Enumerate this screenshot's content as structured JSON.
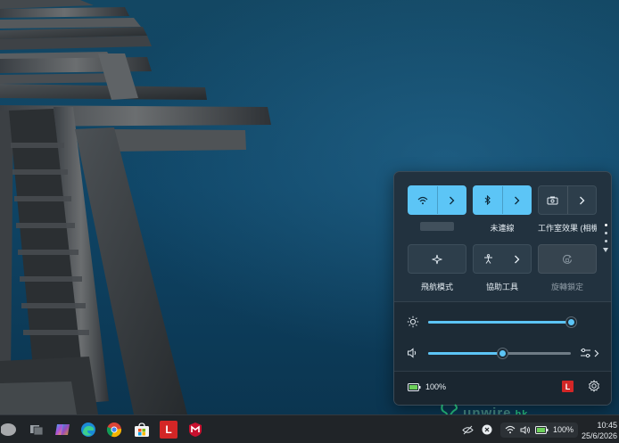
{
  "quick_settings": {
    "tiles": [
      {
        "id": "wifi",
        "label": "",
        "state": "on",
        "icon": "wifi-icon",
        "has_chevron": true
      },
      {
        "id": "bluetooth",
        "label": "未連線",
        "state": "on",
        "icon": "bluetooth-icon",
        "has_chevron": true
      },
      {
        "id": "studio_effects",
        "label": "工作室效果 (相機)",
        "state": "off",
        "icon": "camera-effects-icon",
        "has_chevron": true
      },
      {
        "id": "airplane",
        "label": "飛航模式",
        "state": "off",
        "icon": "airplane-icon",
        "has_chevron": false
      },
      {
        "id": "accessibility",
        "label": "協助工具",
        "state": "off",
        "icon": "accessibility-icon",
        "has_chevron": true
      },
      {
        "id": "rotation_lock",
        "label": "旋轉鎖定",
        "state": "disabled",
        "icon": "rotation-lock-icon",
        "has_chevron": false
      }
    ],
    "pager": {
      "pages": 3,
      "active": 0
    },
    "brightness": {
      "icon": "brightness-icon",
      "level_percent": 100
    },
    "volume": {
      "icon": "speaker-icon",
      "level_percent": 52,
      "extra_icon": "audio-output-icon"
    },
    "battery": {
      "icon": "battery-icon",
      "label": "100%"
    },
    "app_badge": {
      "letter": "L",
      "color": "#d32626"
    },
    "settings_icon": "gear-icon"
  },
  "taskbar": {
    "apps": [
      {
        "name": "start-button",
        "icon": "start-icon"
      },
      {
        "name": "taskbar-app-task-view",
        "icon": "task-view-icon"
      },
      {
        "name": "taskbar-app-copilot",
        "icon": "copilot-icon"
      },
      {
        "name": "taskbar-app-edge",
        "icon": "edge-icon"
      },
      {
        "name": "taskbar-app-chrome",
        "icon": "chrome-icon"
      },
      {
        "name": "taskbar-app-store",
        "icon": "store-icon"
      },
      {
        "name": "taskbar-app-lenovo",
        "icon": "lenovo-icon",
        "letter": "L"
      },
      {
        "name": "taskbar-app-mcafee",
        "icon": "mcafee-icon"
      }
    ],
    "tray": {
      "battery_label": "100%",
      "time": "10:45",
      "date": "25/6/2026"
    }
  },
  "watermark": {
    "text": "unwire",
    "suffix": ".hk"
  },
  "colors": {
    "accent": "#5cc5f6",
    "panel": "#22323f",
    "taskbar": "#202428"
  }
}
